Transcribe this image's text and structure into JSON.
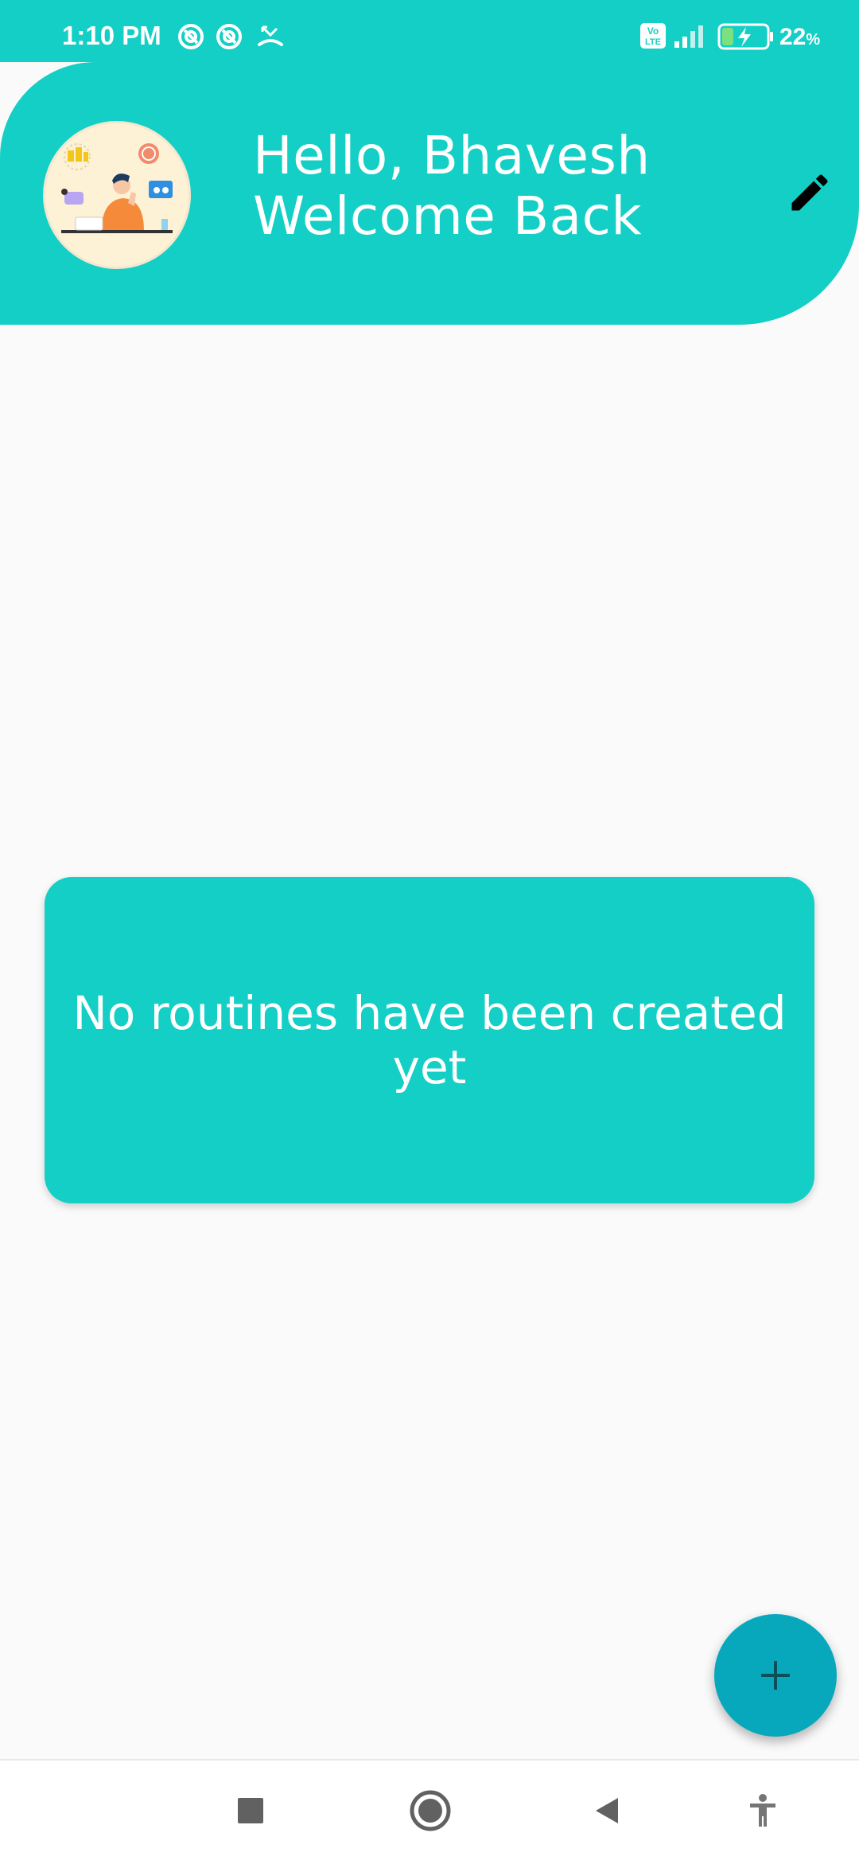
{
  "status_bar": {
    "time": "1:10 PM",
    "battery_percent": "22",
    "battery_unit": "%",
    "battery_level": 0.22,
    "icons": [
      "at-sign-icon",
      "at-sign-icon",
      "missed-call-icon",
      "volte-icon",
      "signal-icon",
      "battery-charging-icon"
    ]
  },
  "header": {
    "greeting_line1": "Hello, Bhavesh",
    "greeting_line2": "Welcome Back",
    "avatar_icon": "user-avatar-illustration",
    "edit_icon": "pencil-edit-icon"
  },
  "main": {
    "empty_message": "No routines have been created yet"
  },
  "fab": {
    "icon": "plus-icon"
  },
  "nav_bar": {
    "buttons": [
      "recents-square-icon",
      "home-circle-icon",
      "back-triangle-icon",
      "accessibility-icon"
    ]
  },
  "colors": {
    "primary": "#13CFC5",
    "fab": "#08A8BC",
    "background": "#FAFAFA",
    "text_on_primary": "#FFFFFF"
  }
}
